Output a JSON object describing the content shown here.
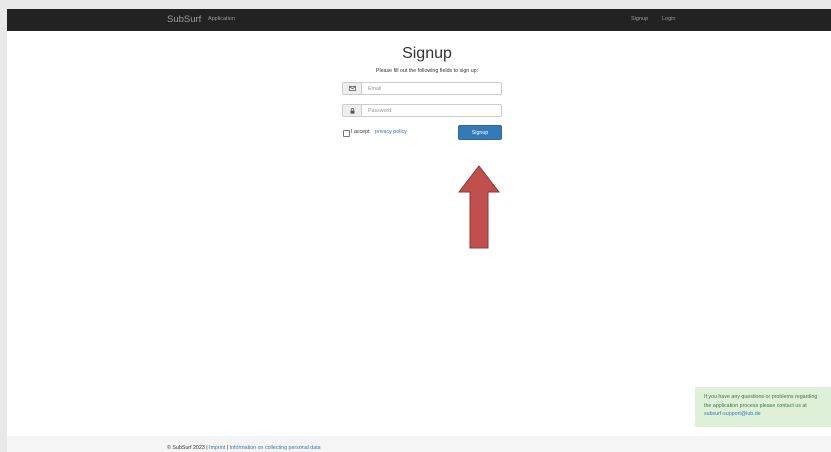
{
  "navbar": {
    "brand": "SubSurf",
    "app_link": "Application",
    "signup_link": "Signup",
    "login_link": "Login"
  },
  "form": {
    "title": "Signup",
    "subtitle": "Please fill out the following fields to sign up:",
    "email_placeholder": "Email",
    "email_value": "",
    "password_placeholder": "Password",
    "password_value": "",
    "email_icon": "envelope-icon",
    "password_icon": "lock-icon",
    "accept_prefix": "I accept",
    "privacy_link": "privacy policy",
    "privacy_checked": false,
    "submit_label": "Signup"
  },
  "annotation": {
    "arrow_color": "#c0504d",
    "arrow_icon": "up-arrow-icon"
  },
  "notice": {
    "text": "If you have any questions or problems regarding the application process please contact us at",
    "email": "subsurf-support@iub.de"
  },
  "footer": {
    "copyright": "© SubSurf 2023 | ",
    "imprint": "Imprint",
    "separator": " | ",
    "data_info": "Information on collecting personal data"
  },
  "colors": {
    "navbar_bg": "#222222",
    "primary": "#337ab7",
    "notice_bg": "#dff0d8"
  }
}
